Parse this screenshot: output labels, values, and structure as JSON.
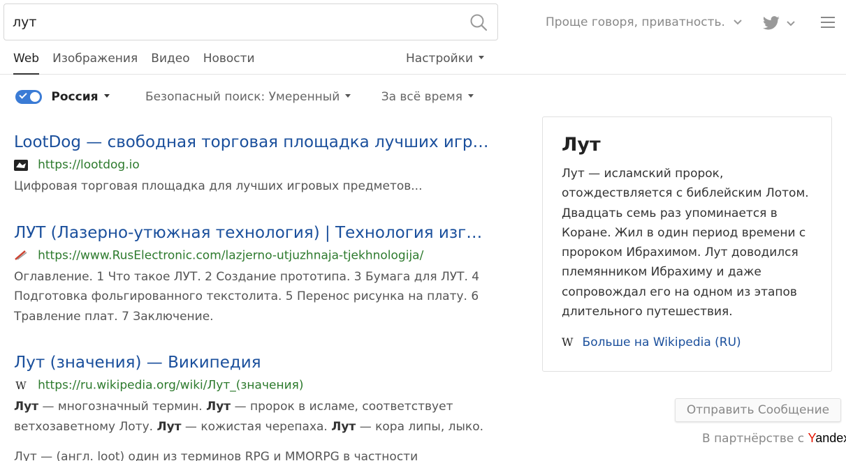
{
  "search": {
    "value": "лут"
  },
  "header": {
    "privacy": "Проще говоря, приватность.",
    "tabs": [
      {
        "label": "Web",
        "active": true
      },
      {
        "label": "Изображения"
      },
      {
        "label": "Видео"
      },
      {
        "label": "Новости"
      }
    ],
    "settings": "Настройки"
  },
  "filters": {
    "region": "Россия",
    "safe_search": "Безопасный поиск: Умеренный",
    "time": "За всё время"
  },
  "results": [
    {
      "title": "LootDog — свободная торговая площадка лучших игровых предметов",
      "url": "https://lootdog.io",
      "favicon": "lootdog-icon",
      "snippet": "Цифровая торговая площадка для лучших игровых предметов..."
    },
    {
      "title": "ЛУТ (Лазерно-утюжная технология) | Технология изготовления печатных плат",
      "url": "https://www.RusElectronic.com/lazjerno-utjuzhnaja-tjekhnologija/",
      "favicon": "ruselectronic-icon",
      "snippet": "Оглавление. 1 Что такое ЛУТ. 2 Создание прототипа. 3 Бумага для ЛУТ. 4 Подготовка фольгированного текстолита. 5 Перенос рисунка на плату. 6 Травление плат. 7 Заключение."
    },
    {
      "title": "Лут (значения) — Википедия",
      "url": "https://ru.wikipedia.org/wiki/Лут_(значения)",
      "favicon": "wikipedia-icon",
      "snippet_parts": [
        {
          "b": "Лут"
        },
        {
          "t": " — многозначный термин. "
        },
        {
          "b": "Лут"
        },
        {
          "t": " — пророк в исламе, соответствует ветхозаветному Лоту. "
        },
        {
          "b": "Лут"
        },
        {
          "t": " — кожистая черепаха. "
        },
        {
          "b": "Лут"
        },
        {
          "t": " — кора липы, лыко."
        }
      ]
    }
  ],
  "cutoff_text": "Лут — (англ. loot) один из терминов RPG и MMORPG в частности",
  "knowledge_panel": {
    "title": "Лут",
    "text": "Лут — исламский пророк, отождествляется с библейским Лотом. Двадцать семь раз упоминается в Коране. Жил в один период времени с пророком Ибрахимом. Лут доводился племянником Ибрахиму и даже сопровождал его на одном из этапов длительного путешествия.",
    "wiki_glyph": "W",
    "link": "Больше на Wikipedia (RU)"
  },
  "feedback": "Отправить Сообщение",
  "partner": {
    "text": "В партнёрстве с",
    "brand_first": "Y",
    "brand_rest": "andex"
  },
  "colors": {
    "accent": "#3a7bd5",
    "link": "#1a4f9c",
    "url": "#2d7a2d"
  }
}
